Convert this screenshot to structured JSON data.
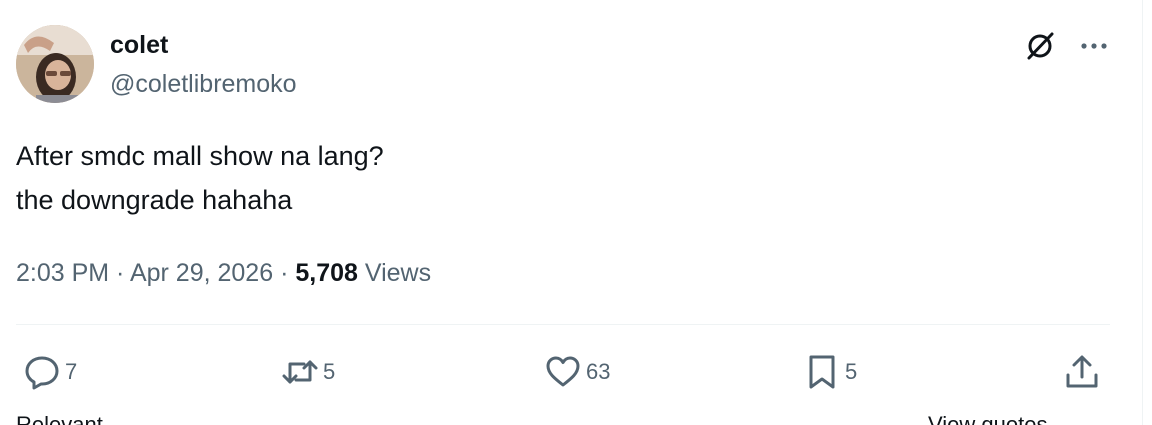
{
  "author": {
    "display_name": "colet",
    "handle": "@coletlibremoko"
  },
  "tweet": {
    "lines": [
      "After smdc mall show na lang?",
      "the downgrade hahaha"
    ]
  },
  "meta": {
    "time": "2:03 PM",
    "separator": " · ",
    "date": "Apr 29, 2026",
    "views_count": "5,708",
    "views_label": "Views"
  },
  "actions": {
    "reply_count": "7",
    "repost_count": "5",
    "like_count": "63",
    "bookmark_count": "5"
  },
  "icons": {
    "grok": "grok-icon",
    "more": "more-icon",
    "reply": "reply-icon",
    "repost": "repost-icon",
    "like": "heart-icon",
    "bookmark": "bookmark-icon",
    "share": "share-icon"
  },
  "footer_cut": {
    "left": "Relevant",
    "right": "View quotes"
  }
}
